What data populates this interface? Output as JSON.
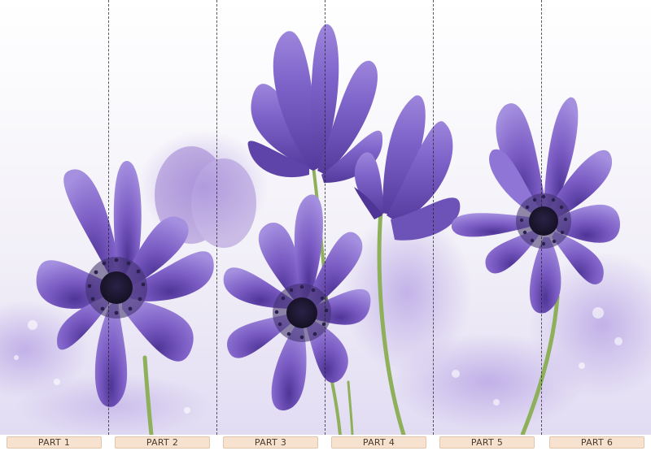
{
  "panels": [
    {
      "label": "PART 1"
    },
    {
      "label": "PART 2"
    },
    {
      "label": "PART 3"
    },
    {
      "label": "PART 4"
    },
    {
      "label": "PART 5"
    },
    {
      "label": "PART 6"
    }
  ],
  "colors": {
    "petal": "#7b5cc4",
    "petal_light": "#a590e0",
    "petal_dark": "#4f3596",
    "center": "#1d1730",
    "stem": "#8fb05a",
    "background": "#f6f4fb",
    "label_bg": "#f7e2cf"
  }
}
